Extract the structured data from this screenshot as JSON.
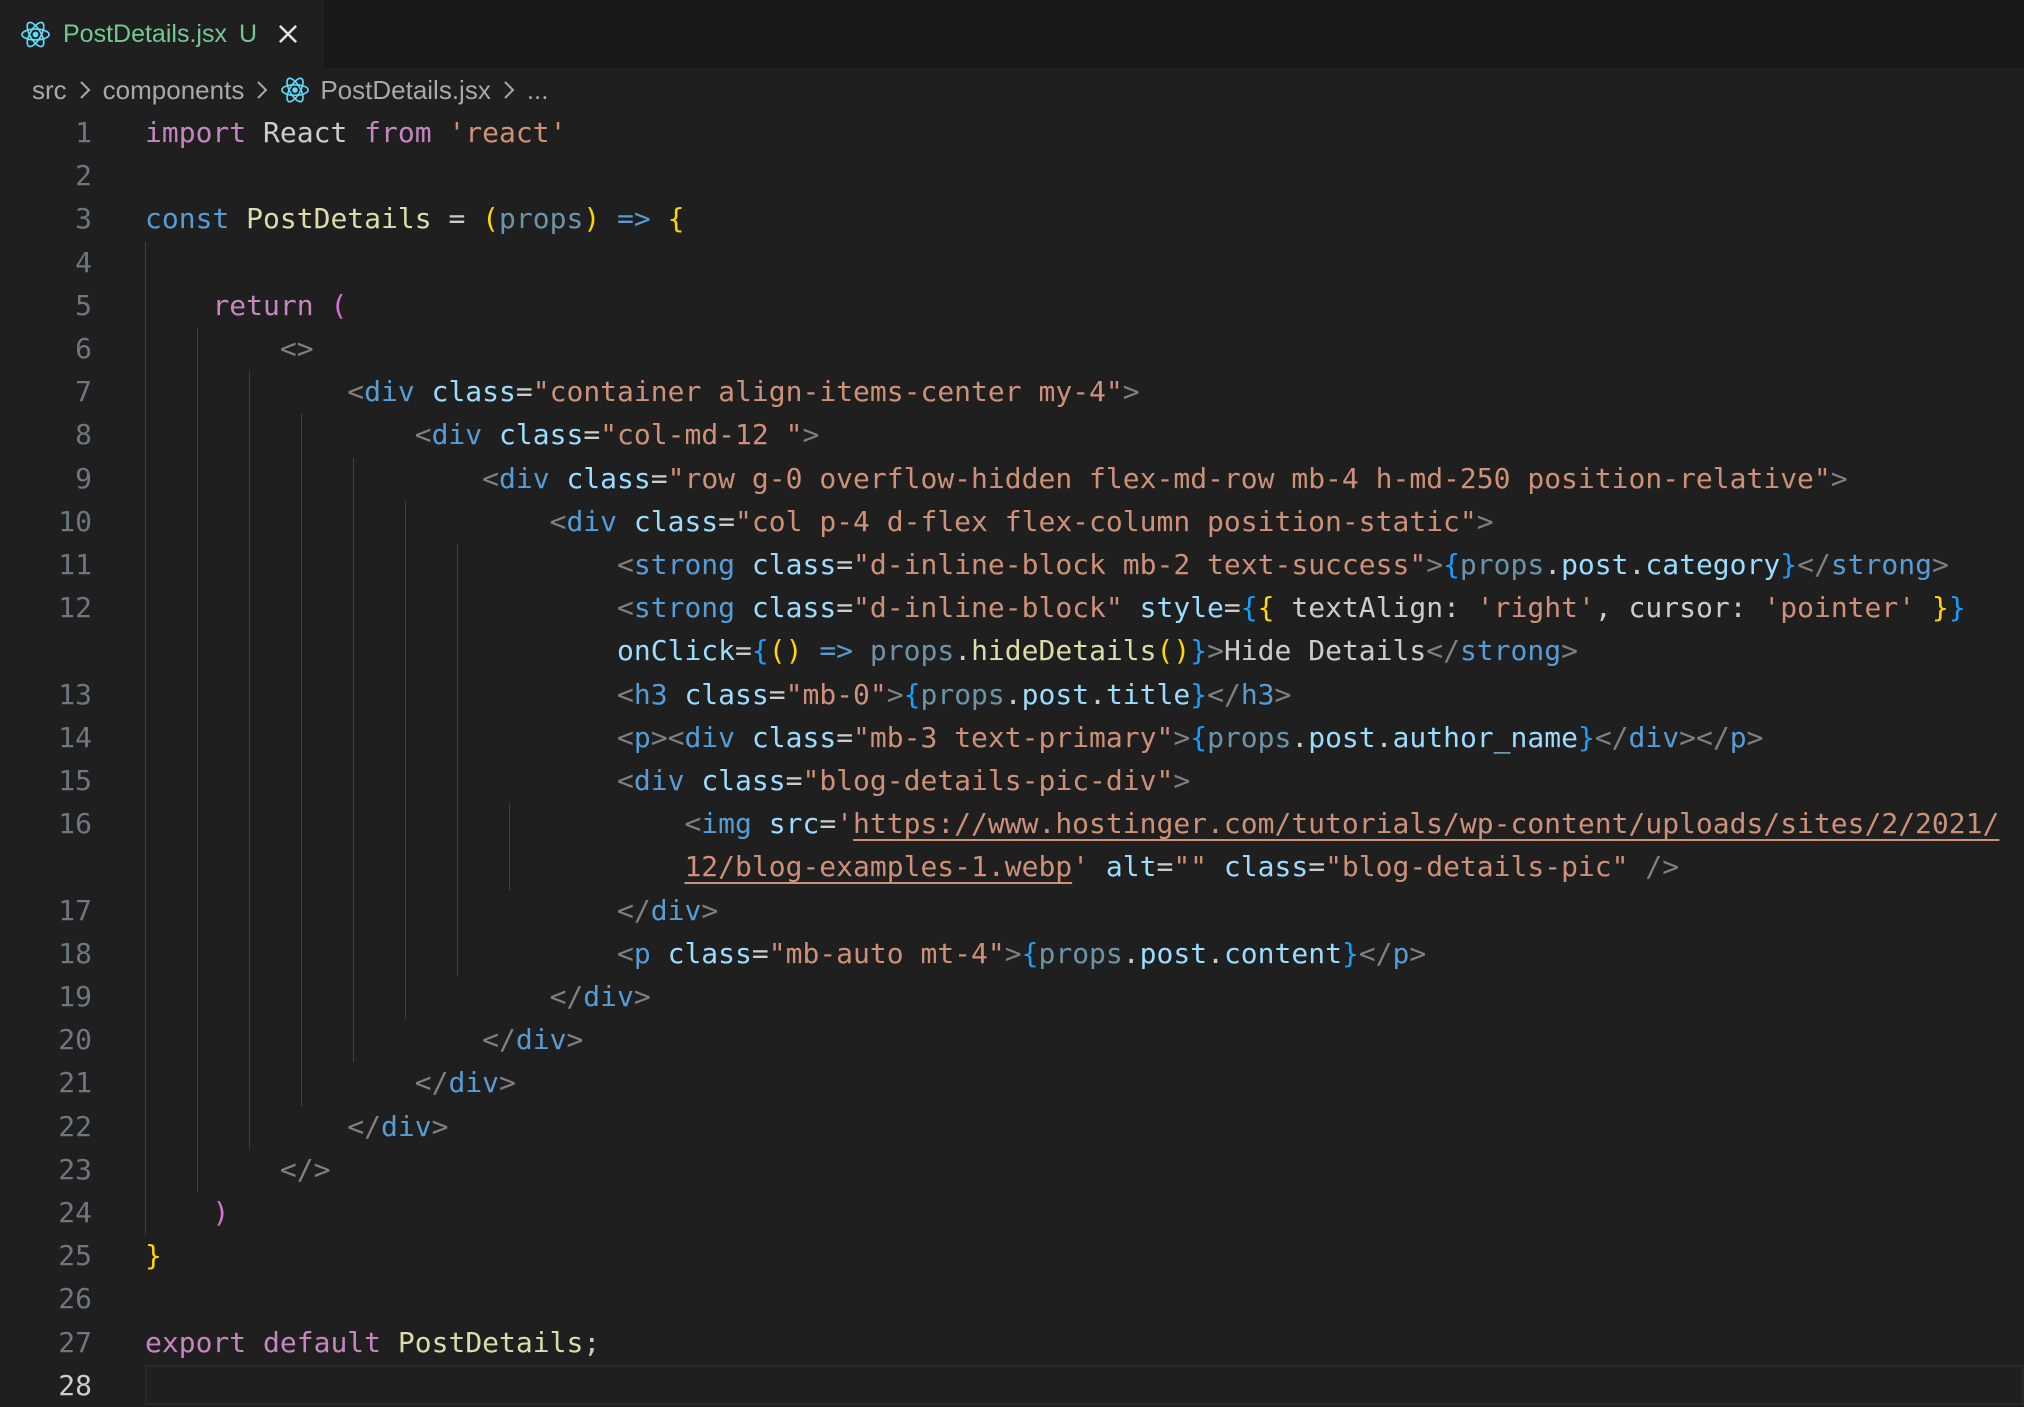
{
  "tab": {
    "icon": "react-icon",
    "title": "PostDetails.jsx",
    "status": "U",
    "close_icon": "close-icon"
  },
  "breadcrumb": {
    "items": [
      "src",
      "components",
      "PostDetails.jsx",
      "..."
    ]
  },
  "editor": {
    "active_line": 28,
    "line_numbers": [
      "1",
      "2",
      "3",
      "4",
      "5",
      "6",
      "7",
      "8",
      "9",
      "10",
      "11",
      "12",
      "",
      "13",
      "14",
      "15",
      "16",
      "",
      "17",
      "18",
      "19",
      "20",
      "21",
      "22",
      "23",
      "24",
      "25",
      "26",
      "27",
      "28"
    ],
    "code_lines": [
      [
        "import",
        " React ",
        "from",
        " ",
        "'react'"
      ],
      [],
      [
        "const",
        " ",
        "PostDetails",
        " = ",
        "(",
        "props",
        ")",
        " ",
        "=>",
        " ",
        "{"
      ],
      [],
      [
        "    ",
        "return",
        " ",
        "("
      ],
      [
        "        ",
        "<>"
      ],
      [
        "            ",
        "<",
        "div",
        " ",
        "class",
        "=",
        "\"container align-items-center my-4\"",
        ">"
      ],
      [
        "                ",
        "<",
        "div",
        " ",
        "class",
        "=",
        "\"col-md-12 \"",
        ">"
      ],
      [
        "                    ",
        "<",
        "div",
        " ",
        "class",
        "=",
        "\"row g-0 overflow-hidden flex-md-row mb-4 h-md-250 position-relative\"",
        ">"
      ],
      [
        "                        ",
        "<",
        "div",
        " ",
        "class",
        "=",
        "\"col p-4 d-flex flex-column position-static\"",
        ">"
      ],
      [
        "                            ",
        "<",
        "strong",
        " ",
        "class",
        "=",
        "\"d-inline-block mb-2 text-success\"",
        ">",
        "{",
        "props",
        ".",
        "post",
        ".",
        "category",
        "}",
        "</",
        "strong",
        ">"
      ],
      [
        "                            ",
        "<",
        "strong",
        " ",
        "class",
        "=",
        "\"d-inline-block\"",
        " ",
        "style",
        "=",
        "{",
        "{",
        " textAlign",
        ": ",
        "'right'",
        ", cursor",
        ": ",
        "'pointer'",
        " ",
        "}",
        "}"
      ],
      [
        "                            ",
        "onClick",
        "=",
        "{",
        "(",
        ")",
        " ",
        "=>",
        " ",
        "props",
        ".",
        "hideDetails",
        "(",
        ")",
        "}",
        ">",
        "Hide Details",
        "</",
        "strong",
        ">"
      ],
      [
        "                            ",
        "<",
        "h3",
        " ",
        "class",
        "=",
        "\"mb-0\"",
        ">",
        "{",
        "props",
        ".",
        "post",
        ".",
        "title",
        "}",
        "</",
        "h3",
        ">"
      ],
      [
        "                            ",
        "<",
        "p",
        ">",
        "<",
        "div",
        " ",
        "class",
        "=",
        "\"mb-3 text-primary\"",
        ">",
        "{",
        "props",
        ".",
        "post",
        ".",
        "author_name",
        "}",
        "</",
        "div",
        ">",
        "</",
        "p",
        ">"
      ],
      [
        "                            ",
        "<",
        "div",
        " ",
        "class",
        "=",
        "\"blog-details-pic-div\"",
        ">"
      ],
      [
        "                                ",
        "<",
        "img",
        " ",
        "src",
        "=",
        "'",
        "https://www.hostinger.com/tutorials/wp-content/uploads/sites/2/2021/"
      ],
      [
        "                                ",
        "12/blog-examples-1.webp",
        "'",
        " ",
        "alt",
        "=",
        "\"\"",
        " ",
        "class",
        "=",
        "\"blog-details-pic\"",
        " ",
        "/>"
      ],
      [
        "                            ",
        "</",
        "div",
        ">"
      ],
      [
        "                            ",
        "<",
        "p",
        " ",
        "class",
        "=",
        "\"mb-auto mt-4\"",
        ">",
        "{",
        "props",
        ".",
        "post",
        ".",
        "content",
        "}",
        "</",
        "p",
        ">"
      ],
      [
        "                        ",
        "</",
        "div",
        ">"
      ],
      [
        "                    ",
        "</",
        "div",
        ">"
      ],
      [
        "                ",
        "</",
        "div",
        ">"
      ],
      [
        "            ",
        "</",
        "div",
        ">"
      ],
      [
        "        ",
        "</>"
      ],
      [
        "    ",
        ")"
      ],
      [
        "}"
      ],
      [],
      [
        "export",
        " ",
        "default",
        " ",
        "PostDetails",
        ";"
      ],
      []
    ]
  },
  "colors": {
    "background": "#1f1f1f",
    "tab_text": "#73c991",
    "react_icon": "#61dafb",
    "keyword": "#c586c0",
    "string": "#ce9178",
    "tag": "#569cd6",
    "bracket_gold": "#ffd700",
    "bracket_violet": "#da70d6",
    "bracket_blue": "#179fff"
  }
}
